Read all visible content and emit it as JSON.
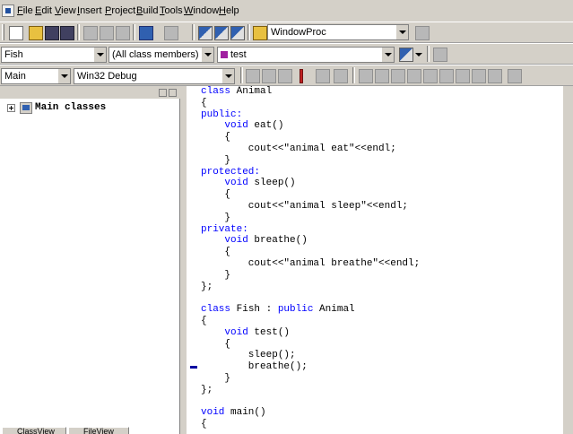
{
  "menu": {
    "items": [
      "File",
      "Edit",
      "View",
      "Insert",
      "Project",
      "Build",
      "Tools",
      "Window",
      "Help"
    ],
    "underline": [
      "F",
      "E",
      "V",
      "I",
      "P",
      "B",
      "T",
      "W",
      "H"
    ]
  },
  "toolbar1": {
    "function_combo": "WindowProc"
  },
  "toolbar2": {
    "class_combo": "Fish",
    "members_combo": "(All class members)",
    "function_combo": "test"
  },
  "toolbar3": {
    "project_combo": "Main",
    "config_combo": "Win32 Debug"
  },
  "classview": {
    "root_label": "Main classes",
    "tabs": [
      "ClassView",
      "FileView"
    ]
  },
  "editor": {
    "lines": [
      {
        "text": "class Animal",
        "kw": [
          "class"
        ]
      },
      {
        "text": "{",
        "kw": []
      },
      {
        "text": "public:",
        "kw": [
          "public:"
        ]
      },
      {
        "text": "    void eat()",
        "kw": [
          "void"
        ]
      },
      {
        "text": "    {",
        "kw": []
      },
      {
        "text": "        cout<<\"animal eat\"<<endl;",
        "kw": []
      },
      {
        "text": "    }",
        "kw": []
      },
      {
        "text": "protected:",
        "kw": [
          "protected:"
        ]
      },
      {
        "text": "    void sleep()",
        "kw": [
          "void"
        ]
      },
      {
        "text": "    {",
        "kw": []
      },
      {
        "text": "        cout<<\"animal sleep\"<<endl;",
        "kw": []
      },
      {
        "text": "    }",
        "kw": []
      },
      {
        "text": "private:",
        "kw": [
          "private:"
        ]
      },
      {
        "text": "    void breathe()",
        "kw": [
          "void"
        ]
      },
      {
        "text": "    {",
        "kw": []
      },
      {
        "text": "        cout<<\"animal breathe\"<<endl;",
        "kw": []
      },
      {
        "text": "    }",
        "kw": []
      },
      {
        "text": "};",
        "kw": []
      },
      {
        "text": "",
        "kw": []
      },
      {
        "text": "class Fish : public Animal",
        "kw": [
          "class",
          "public"
        ]
      },
      {
        "text": "{",
        "kw": []
      },
      {
        "text": "    void test()",
        "kw": [
          "void"
        ]
      },
      {
        "text": "    {",
        "kw": []
      },
      {
        "text": "        sleep();",
        "kw": []
      },
      {
        "text": "        breathe();",
        "kw": []
      },
      {
        "text": "    }",
        "kw": []
      },
      {
        "text": "};",
        "kw": []
      },
      {
        "text": "",
        "kw": []
      },
      {
        "text": "void main()",
        "kw": [
          "void"
        ]
      },
      {
        "text": "{",
        "kw": []
      }
    ],
    "keyword_color": "#0000ff"
  }
}
